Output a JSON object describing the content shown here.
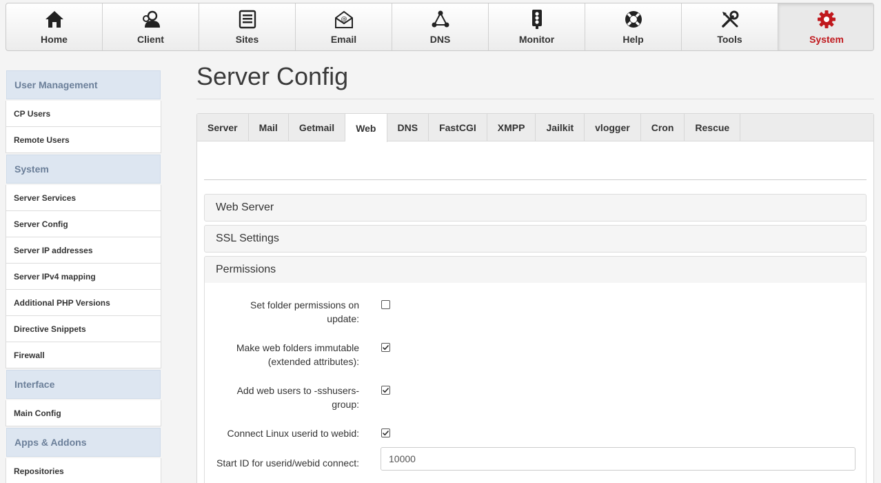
{
  "topnav": [
    {
      "label": "Home",
      "icon": "home-icon"
    },
    {
      "label": "Client",
      "icon": "client-icon"
    },
    {
      "label": "Sites",
      "icon": "sites-icon"
    },
    {
      "label": "Email",
      "icon": "email-icon"
    },
    {
      "label": "DNS",
      "icon": "dns-icon"
    },
    {
      "label": "Monitor",
      "icon": "monitor-icon"
    },
    {
      "label": "Help",
      "icon": "help-icon"
    },
    {
      "label": "Tools",
      "icon": "tools-icon"
    },
    {
      "label": "System",
      "icon": "gear-icon",
      "active": true
    }
  ],
  "colors": {
    "accent": "#c0181d",
    "section_bg": "#dde6f1",
    "section_text": "#6b7f99"
  },
  "sidebar": {
    "sections": [
      {
        "title": "User Management",
        "items": [
          "CP Users",
          "Remote Users"
        ]
      },
      {
        "title": "System",
        "items": [
          "Server Services",
          "Server Config",
          "Server IP addresses",
          "Server IPv4 mapping",
          "Additional PHP Versions",
          "Directive Snippets",
          "Firewall"
        ]
      },
      {
        "title": "Interface",
        "items": [
          "Main Config"
        ]
      },
      {
        "title": "Apps & Addons",
        "items": [
          "Repositories"
        ]
      }
    ]
  },
  "main": {
    "title": "Server Config",
    "tabs": [
      "Server",
      "Mail",
      "Getmail",
      "Web",
      "DNS",
      "FastCGI",
      "XMPP",
      "Jailkit",
      "vlogger",
      "Cron",
      "Rescue"
    ],
    "active_tab": "Web",
    "accordion": {
      "web_server": "Web Server",
      "ssl_settings": "SSL Settings",
      "permissions": "Permissions"
    },
    "form": {
      "set_folder_permissions": {
        "label_line1": "Set folder permissions on",
        "label_line2": "update:",
        "checked": false
      },
      "immutable": {
        "label_line1": "Make web folders immutable",
        "label_line2": "(extended attributes):",
        "checked": true
      },
      "sshusers": {
        "label_line1": "Add web users to -sshusers-",
        "label_line2": "group:",
        "checked": true
      },
      "connect_userid": {
        "label": "Connect Linux userid to webid:",
        "checked": true
      },
      "start_id": {
        "label": "Start ID for userid/webid connect:",
        "value": "10000"
      }
    }
  }
}
